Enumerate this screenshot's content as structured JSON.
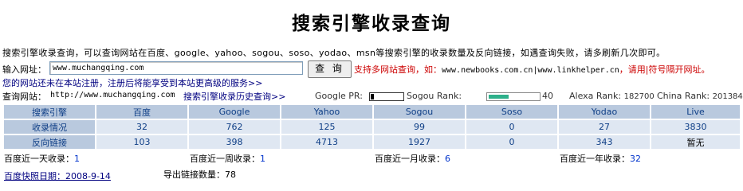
{
  "page": {
    "title": "搜索引擎收录查询",
    "description": "搜索引擎收录查询，可以查询网站在百度、google、yahoo、sogou、soso、yodao、msn等搜索引擎的收录数量及反向链接，如遇查询失败，请多刷新几次即可。"
  },
  "form": {
    "label": "输入网址：",
    "value": "www.muchangqing.com",
    "button": "查 询",
    "note": "支持多网站查询，如：",
    "example": "www.newbooks.com.cn|www.linkhelper.cn",
    "note2": "，请用|符号隔开网址。",
    "register_link": "您的网站还未在本站注册，注册后将能享受到本站更高级的服务>>"
  },
  "query": {
    "label": "查询网站：",
    "url": "http://www.muchangqing.com",
    "history_link": "搜索引擎收录历史查询>>"
  },
  "ranks": {
    "pr_label": "Google PR:",
    "pr_value": 0,
    "sogou_label": "Sogou Rank:",
    "sogou_value": "40",
    "sogou_fraction": 0.4,
    "alexa_label": "Alexa Rank:",
    "alexa_value": "182700",
    "china_label": "China Rank:",
    "china_value": "201384"
  },
  "table": {
    "header": [
      "搜索引擎",
      "百度",
      "Google",
      "Yahoo",
      "Sogou",
      "Soso",
      "Yodao",
      "Live"
    ],
    "rows": [
      [
        "收录情况",
        "32",
        "762",
        "125",
        "99",
        "0",
        "27",
        "3830"
      ],
      [
        "反向链接",
        "103",
        "398",
        "4713",
        "1927",
        "0",
        "343",
        "暂无"
      ]
    ]
  },
  "stats": {
    "day_label": "百度近一天收录：",
    "day_value": "1",
    "week_label": "百度近一周收录：",
    "week_value": "1",
    "month_label": "百度近一月收录：",
    "month_value": "6",
    "year_label": "百度近一年收录：",
    "year_value": "32",
    "snapshot_label": "百度快照日期：",
    "snapshot_value": "2008-9-14",
    "outlinks_label": "导出链接数量：",
    "outlinks_value": "78"
  },
  "colors": {
    "header_cell": "#b9c9de",
    "data_cell": "#dfe7f2",
    "link": "#0033cc",
    "note": "#cc0000"
  }
}
